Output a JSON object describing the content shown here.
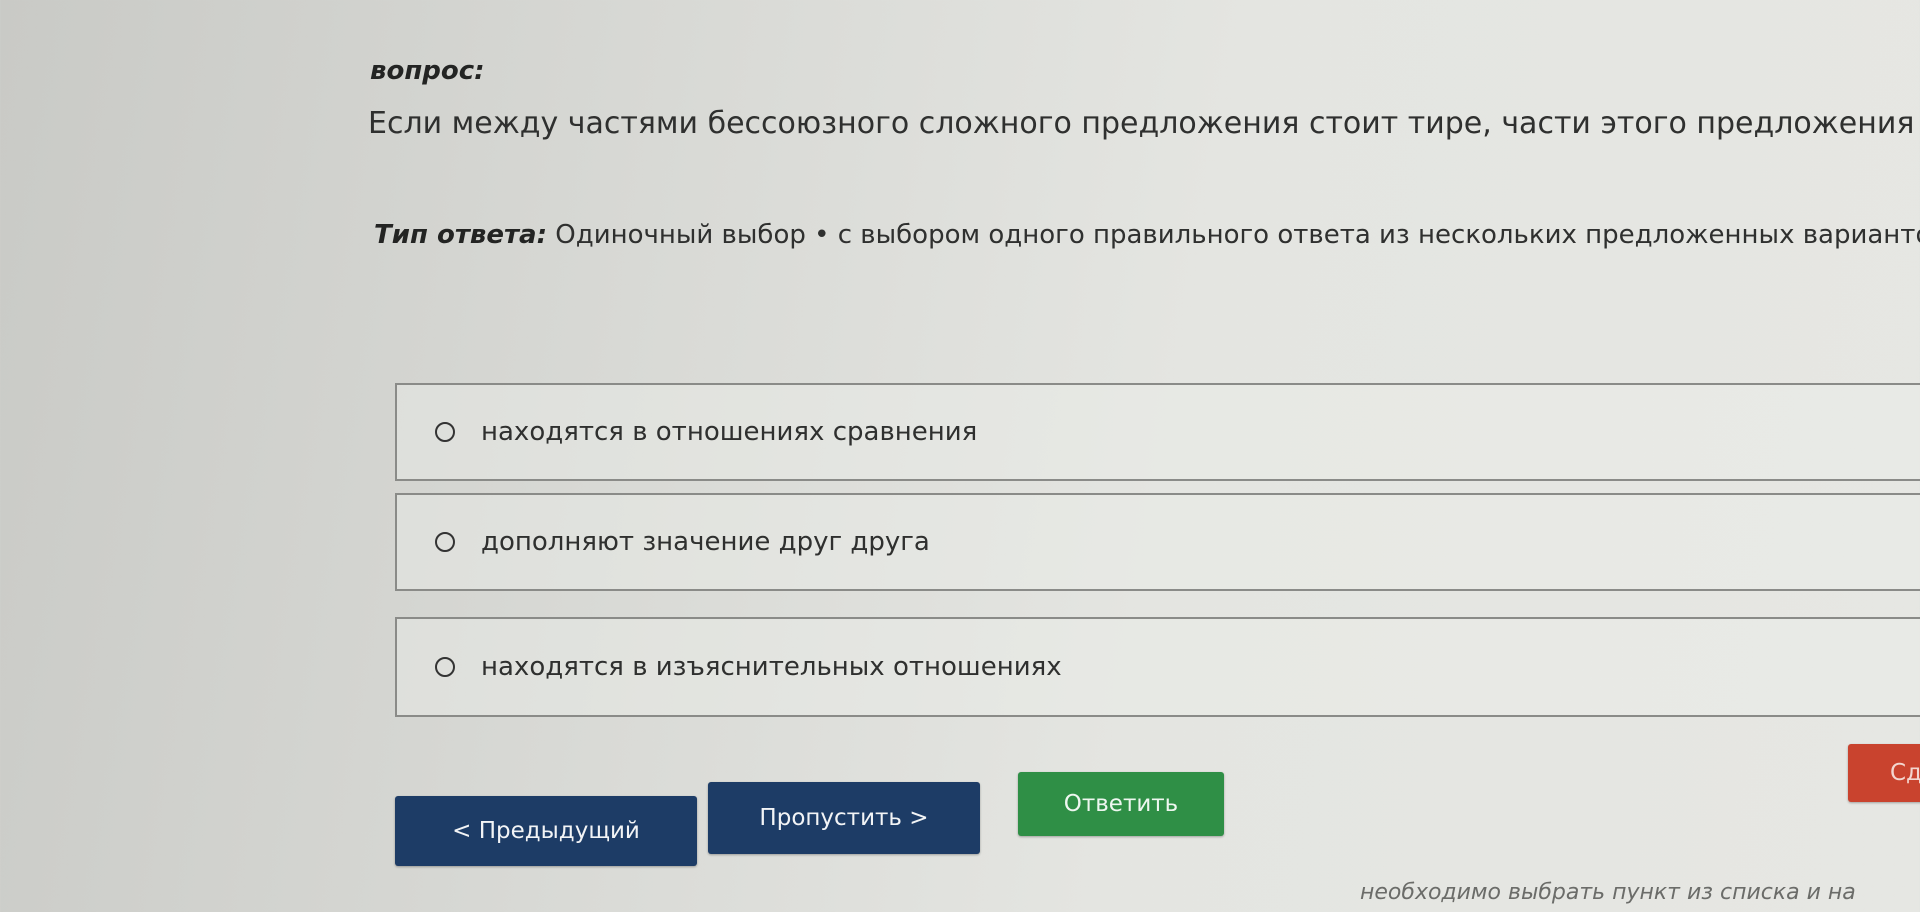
{
  "question": {
    "label": "вопрос:",
    "text": "Если между частями бессоюзного сложного предложения стоит тире, части этого предложения ..."
  },
  "answer_type": {
    "label": "Тип ответа:",
    "value": "Одиночный выбор • с выбором одного правильного ответа из нескольких предложенных вариантов"
  },
  "options": [
    {
      "text": "находятся в отношениях сравнения"
    },
    {
      "text": "дополняют значение друг друга"
    },
    {
      "text": "находятся в изъяснительных отношениях"
    }
  ],
  "buttons": {
    "prev_label": "< Предыдущий",
    "skip_label": "Пропустить >",
    "answer_label": "Ответить",
    "red_label": "Сд"
  },
  "hint": "необходимо выбрать пункт из списка и на",
  "colors": {
    "nav_button": "#1d3c66",
    "answer_button": "#2f8f46",
    "red_button": "#c9432e"
  }
}
